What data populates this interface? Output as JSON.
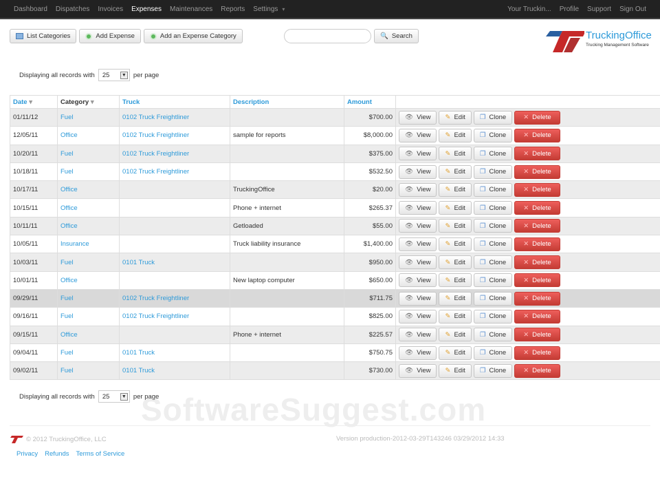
{
  "nav": {
    "left": [
      "Dashboard",
      "Dispatches",
      "Invoices",
      "Expenses",
      "Maintenances",
      "Reports",
      "Settings"
    ],
    "active": "Expenses",
    "right": [
      "Your Truckin...",
      "Profile",
      "Support",
      "Sign Out"
    ]
  },
  "toolbar": {
    "list_categories": "List Categories",
    "add_expense": "Add Expense",
    "add_category": "Add an Expense Category"
  },
  "search": {
    "value": "",
    "button": "Search"
  },
  "logo": {
    "name": "TruckingOffice",
    "tagline": "Trucking Management Software"
  },
  "paging": {
    "prefix": "Displaying all records with",
    "per_page": "25",
    "suffix": "per page"
  },
  "table": {
    "headers": [
      "Date",
      "Category",
      "Truck",
      "Description",
      "Amount"
    ],
    "actions": {
      "view": "View",
      "edit": "Edit",
      "clone": "Clone",
      "delete": "Delete"
    },
    "rows": [
      [
        "01/11/12",
        "Fuel",
        "0102 Truck Freightliner",
        "",
        "$700.00"
      ],
      [
        "12/05/11",
        "Office",
        "0102 Truck Freightliner",
        "sample for reports",
        "$8,000.00"
      ],
      [
        "10/20/11",
        "Fuel",
        "0102 Truck Freightliner",
        "",
        "$375.00"
      ],
      [
        "10/18/11",
        "Fuel",
        "0102 Truck Freightliner",
        "",
        "$532.50"
      ],
      [
        "10/17/11",
        "Office",
        "",
        "TruckingOffice",
        "$20.00"
      ],
      [
        "10/15/11",
        "Office",
        "",
        "Phone + internet",
        "$265.37"
      ],
      [
        "10/11/11",
        "Office",
        "",
        "Getloaded",
        "$55.00"
      ],
      [
        "10/05/11",
        "Insurance",
        "",
        "Truck liability insurance",
        "$1,400.00"
      ],
      [
        "10/03/11",
        "Fuel",
        "0101 Truck",
        "",
        "$950.00"
      ],
      [
        "10/01/11",
        "Office",
        "",
        "New laptop computer",
        "$650.00"
      ],
      [
        "09/29/11",
        "Fuel",
        "0102 Truck Freightliner",
        "",
        "$711.75"
      ],
      [
        "09/16/11",
        "Fuel",
        "0102 Truck Freightliner",
        "",
        "$825.00"
      ],
      [
        "09/15/11",
        "Office",
        "",
        "Phone + internet",
        "$225.57"
      ],
      [
        "09/04/11",
        "Fuel",
        "0101 Truck",
        "",
        "$750.75"
      ],
      [
        "09/02/11",
        "Fuel",
        "0101 Truck",
        "",
        "$730.00"
      ]
    ]
  },
  "footer": {
    "copyright": "© 2012 TruckingOffice, LLC",
    "version": "Version production-2012-03-29T143246 03/29/2012 14:33",
    "links": [
      "Privacy",
      "Refunds",
      "Terms of Service"
    ]
  },
  "watermark": "SoftwareSuggest.com"
}
